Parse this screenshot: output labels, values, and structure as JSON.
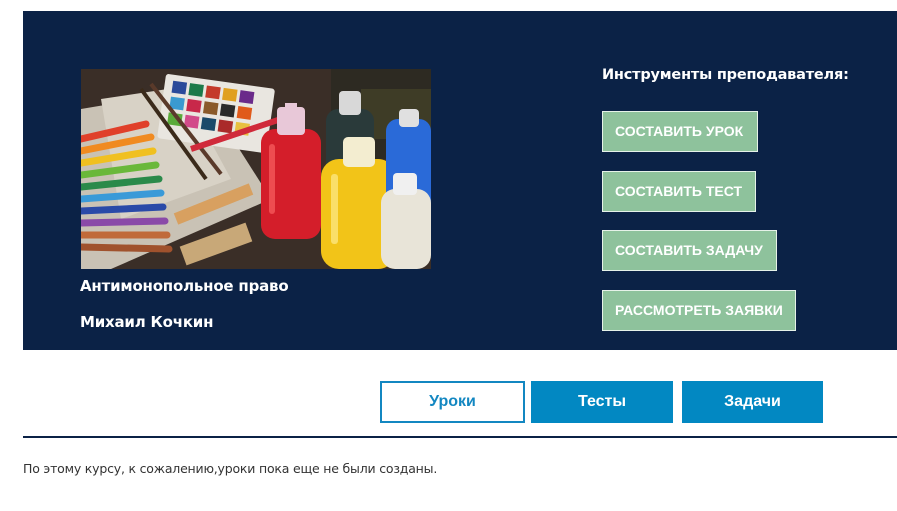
{
  "course": {
    "title": "Антимонопольное право",
    "author": "Михаил Кочкин",
    "image_icon": "course-cover-art-supplies"
  },
  "teacher_tools": {
    "heading": "Инструменты преподавателя:",
    "buttons": [
      {
        "label": "СОСТАВИТЬ УРОК"
      },
      {
        "label": "СОСТАВИТЬ ТЕСТ"
      },
      {
        "label": "СОСТАВИТЬ ЗАДАЧУ"
      },
      {
        "label": "РАССМОТРЕТЬ ЗАЯВКИ"
      }
    ]
  },
  "tabs": [
    {
      "label": "Уроки",
      "active": true
    },
    {
      "label": "Тесты",
      "active": false
    },
    {
      "label": "Задачи",
      "active": false
    }
  ],
  "content": {
    "empty_message": "По этому курсу, к сожалению,уроки пока еще не были созданы."
  },
  "colors": {
    "hero_background": "#0b2246",
    "tool_button": "#8ec29c",
    "tab_active_border": "#1387c1",
    "tab_inactive_background": "#0288c2"
  }
}
